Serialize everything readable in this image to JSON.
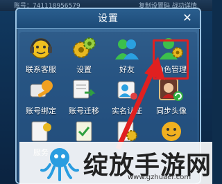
{
  "topbar": {
    "left_text": "账号：741118956579",
    "right_text": "复制设置码 战功详情"
  },
  "dialog": {
    "title": "设置",
    "close_label": "✕"
  },
  "items": [
    {
      "label": "联系客服",
      "icon": "customer-service-icon"
    },
    {
      "label": "设置",
      "icon": "gears-icon"
    },
    {
      "label": "好友",
      "icon": "friends-icon"
    },
    {
      "label": "角色管理",
      "icon": "role-manage-icon"
    },
    {
      "label": "账号绑定",
      "icon": "account-bind-icon"
    },
    {
      "label": "账号迁移",
      "icon": "account-migrate-icon"
    },
    {
      "label": "实名认证",
      "icon": "real-name-icon"
    },
    {
      "label": "同步头像",
      "icon": "sync-avatar-icon"
    },
    {
      "label": "服务",
      "icon": "service-icon"
    },
    {
      "label": "",
      "icon": "checklist-icon"
    },
    {
      "label": "",
      "icon": "settings-doc-icon"
    },
    {
      "label": "",
      "icon": "face-icon"
    }
  ],
  "watermark": {
    "text": "绽放手游网",
    "url": "www.gzhuaer.com"
  },
  "colors": {
    "highlight": "#e02020",
    "dialog": "#2d5d8c"
  }
}
